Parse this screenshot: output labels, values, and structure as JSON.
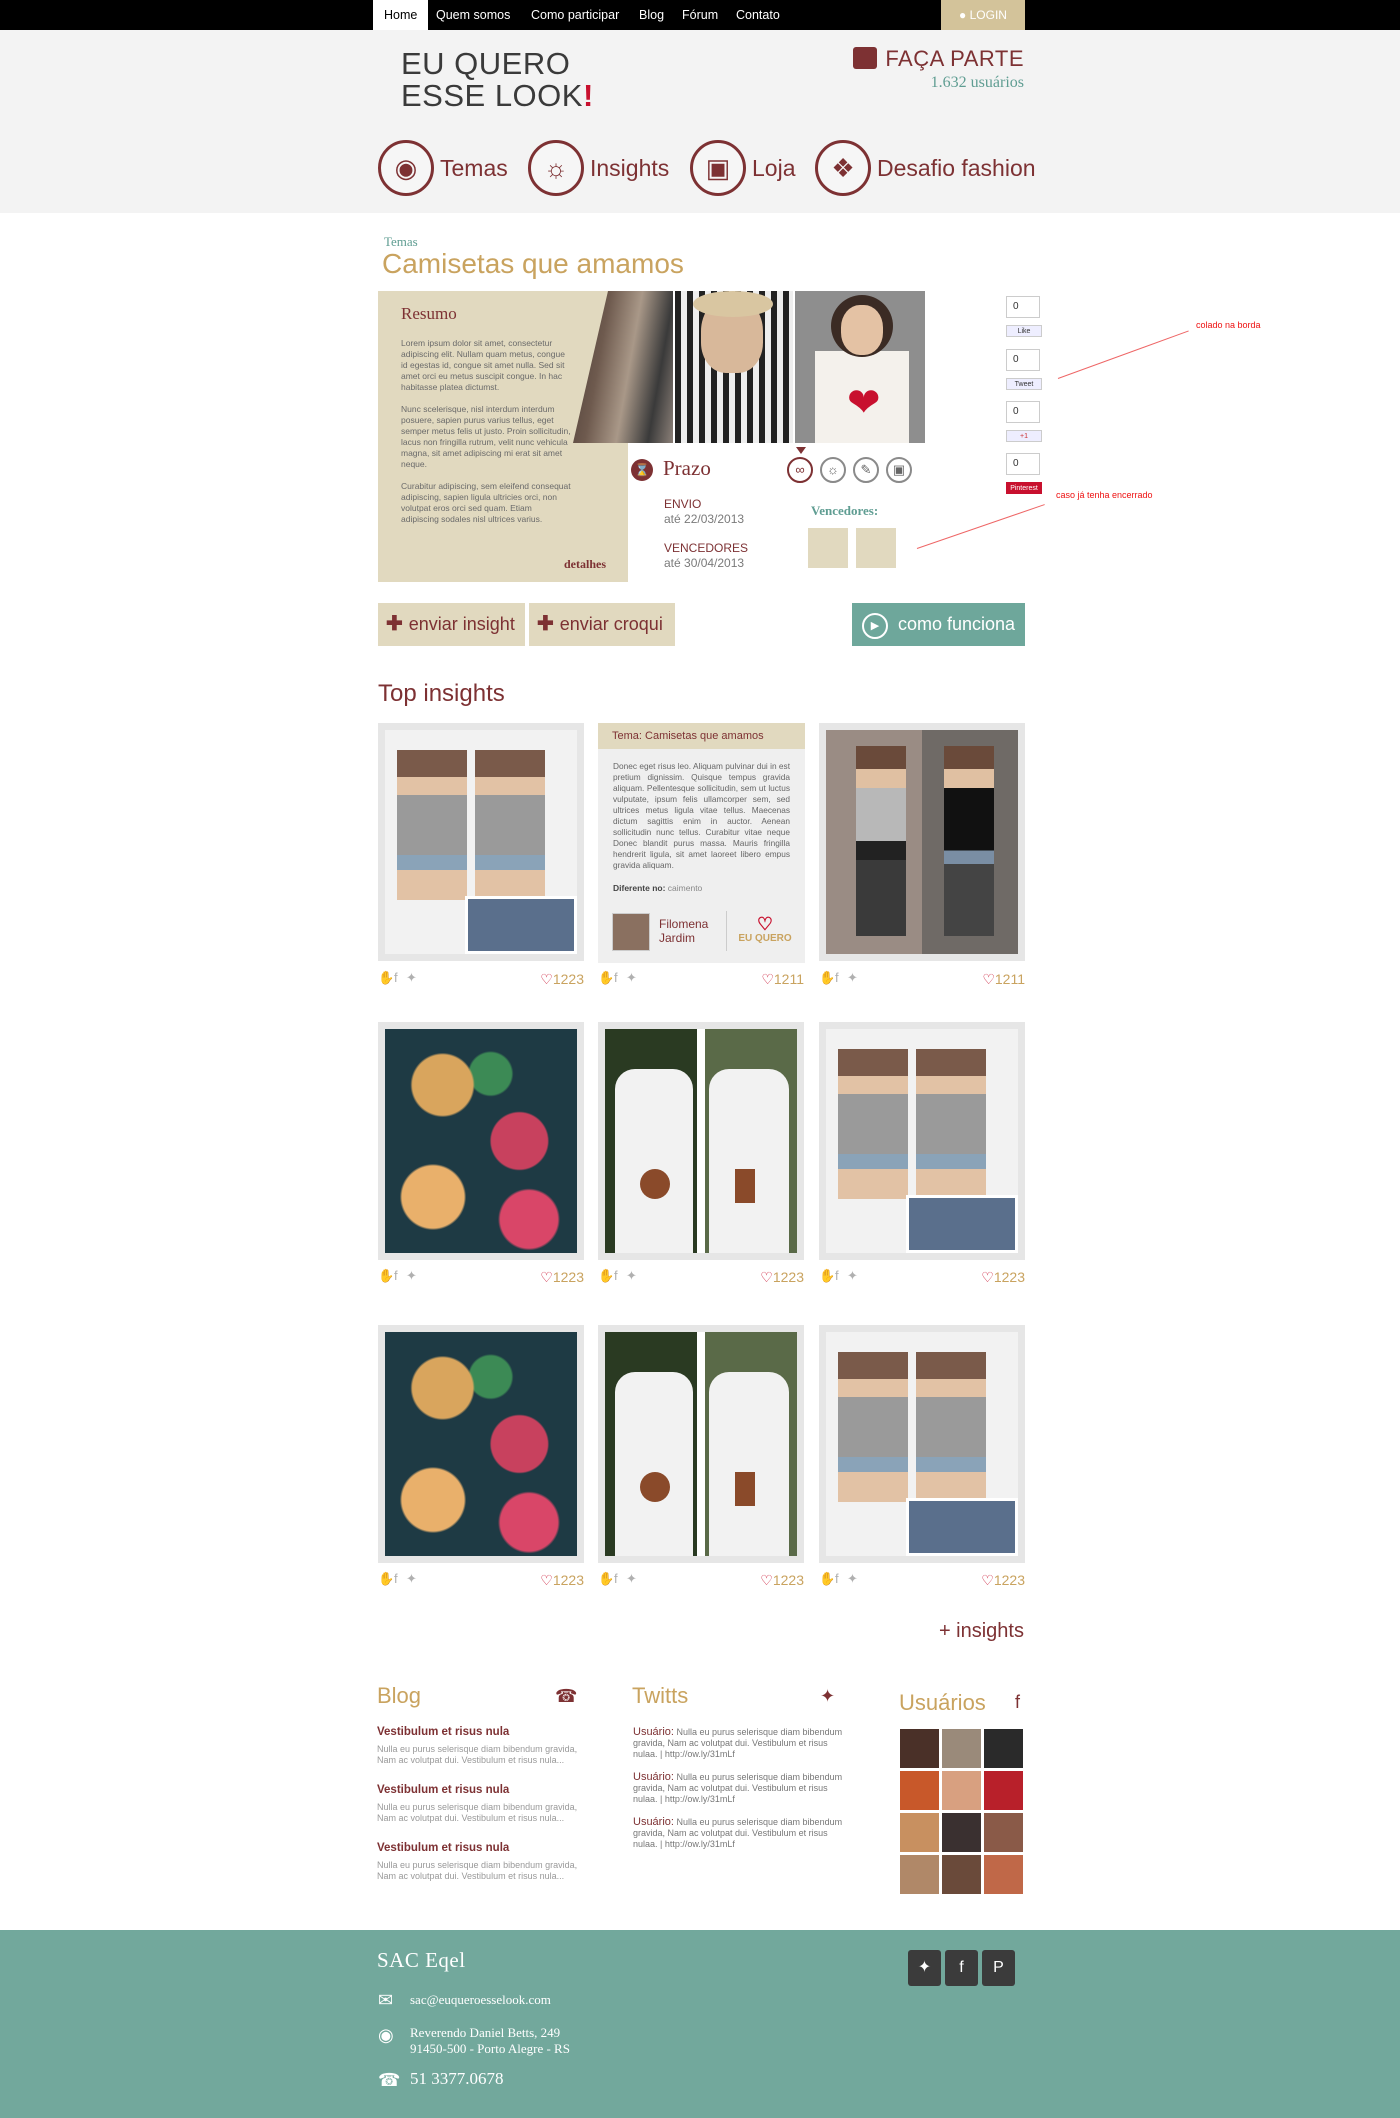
{
  "nav": {
    "items": [
      "Home",
      "Quem somos",
      "Como participar",
      "Blog",
      "Fórum",
      "Contato"
    ],
    "login": "LOGIN"
  },
  "header": {
    "logo_line1": "EU QUERO",
    "logo_line2": "ESSE LOOK",
    "logo_mark": "!",
    "join_label": "FAÇA PARTE",
    "users_count": "1.632 usuários"
  },
  "categories": [
    "Temas",
    "Insights",
    "Loja",
    "Desafio fashion"
  ],
  "page": {
    "breadcrumb": "Temas",
    "title": "Camisetas que amamos"
  },
  "resumo": {
    "title": "Resumo",
    "p1": "Lorem ipsum dolor sit amet, consectetur adipiscing elit. Nullam quam metus, congue id egestas id, congue sit amet nulla. Sed sit amet orci eu metus suscipit congue. In hac habitasse platea dictumst.",
    "p2": "Nunc scelerisque, nisl interdum interdum posuere, sapien purus varius tellus, eget semper metus felis ut justo. Proin sollicitudin, lacus non fringilla rutrum, velit nunc vehicula magna, sit amet adipiscing mi erat sit amet neque.",
    "p3": "Curabitur adipiscing, sem eleifend consequat adipiscing, sapien ligula ultricies orci, non volutpat eros orci sed quam. Etiam adipiscing sodales nisl ultrices varius.",
    "details": "detalhes"
  },
  "prazo": {
    "title": "Prazo",
    "envio_label": "ENVIO",
    "envio_date": "até 22/03/2013",
    "vencedores_label": "VENCEDORES",
    "vencedores_date": "até 30/04/2013"
  },
  "vencedores_title": "Vencedores:",
  "social_counts": [
    "0",
    "0",
    "0",
    "0"
  ],
  "social_buttons": [
    "Like",
    "Tweet",
    "+1",
    "Pinterest"
  ],
  "annotations": {
    "a1": "colado na borda",
    "a2": "caso já tenha encerrado"
  },
  "actions": {
    "insight": "enviar insight",
    "croqui": "enviar croqui",
    "como": "como funciona"
  },
  "top_insights_title": "Top insights",
  "text_card": {
    "header": "Tema: Camisetas que amamos",
    "body": "Donec eget risus leo. Aliquam pulvinar dui in est pretium dignissim. Quisque tempus gravida aliquam. Pellentesque sollicitudin, sem ut luctus vulputate, ipsum felis ullamcorper sem, sed ultrices metus ligula vitae tellus. Maecenas dictum sagittis enim in auctor. Aenean sollicitudin nunc tellus. Curabitur vitae neque Donec blandit purus massa. Mauris fringilla hendrerit ligula, sit amet laoreet libero empus gravida aliquam.",
    "diff_label": "Diferente no:",
    "diff_value": "caimento",
    "author_first": "Filomena",
    "author_last": "Jardim",
    "eu_quero": "EU QUERO"
  },
  "card_counts": [
    "1223",
    "1211",
    "1211",
    "1223",
    "1223",
    "1223",
    "1223",
    "1223",
    "1223"
  ],
  "more_insights": "+ insights",
  "blog": {
    "title": "Blog",
    "posts": [
      {
        "title": "Vestibulum et risus nula",
        "text": "Nulla eu purus selerisque diam bibendum gravida, Nam ac volutpat dui. Vestibulum et risus nula..."
      },
      {
        "title": "Vestibulum et risus nula",
        "text": "Nulla eu purus selerisque diam bibendum gravida, Nam ac volutpat dui. Vestibulum et risus nula..."
      },
      {
        "title": "Vestibulum et risus nula",
        "text": "Nulla eu purus selerisque diam bibendum gravida, Nam ac volutpat dui. Vestibulum et risus nula..."
      }
    ]
  },
  "twitts": {
    "title": "Twitts",
    "items": [
      {
        "user": "Usuário:",
        "text": "Nulla eu purus selerisque diam bibendum gravida, Nam ac volutpat dui. Vestibulum et risus nulaa. | http://ow.ly/31mLf"
      },
      {
        "user": "Usuário:",
        "text": "Nulla eu purus selerisque diam bibendum gravida, Nam ac volutpat dui. Vestibulum et risus nulaa. | http://ow.ly/31mLf"
      },
      {
        "user": "Usuário:",
        "text": "Nulla eu purus selerisque diam bibendum gravida, Nam ac volutpat dui. Vestibulum et risus nulaa. | http://ow.ly/31mLf"
      }
    ]
  },
  "usuarios_title": "Usuários",
  "footer": {
    "title": "SAC Eqel",
    "email": "sac@euqueroesselook.com",
    "address1": "Reverendo Daniel Betts, 249",
    "address2": "91450-500 - Porto Alegre - RS",
    "phone": "51 3377.0678"
  },
  "colors": {
    "brand_dark": "#7d3133",
    "gold": "#c9a35f",
    "beige": "#e1d9bf",
    "teal": "#6ea79b",
    "footer": "#72a89c"
  },
  "icons": [
    "user-icon",
    "speech-bubble-icon",
    "shirt-icon",
    "lightbulb-icon",
    "shopping-bag-icon",
    "puzzle-icon",
    "hourglass-icon",
    "heart-icon",
    "twitter-bird-icon",
    "facebook-icon",
    "pinterest-icon",
    "thumbs-up-icon",
    "play-icon",
    "mail-icon",
    "pin-icon",
    "phone-icon"
  ]
}
